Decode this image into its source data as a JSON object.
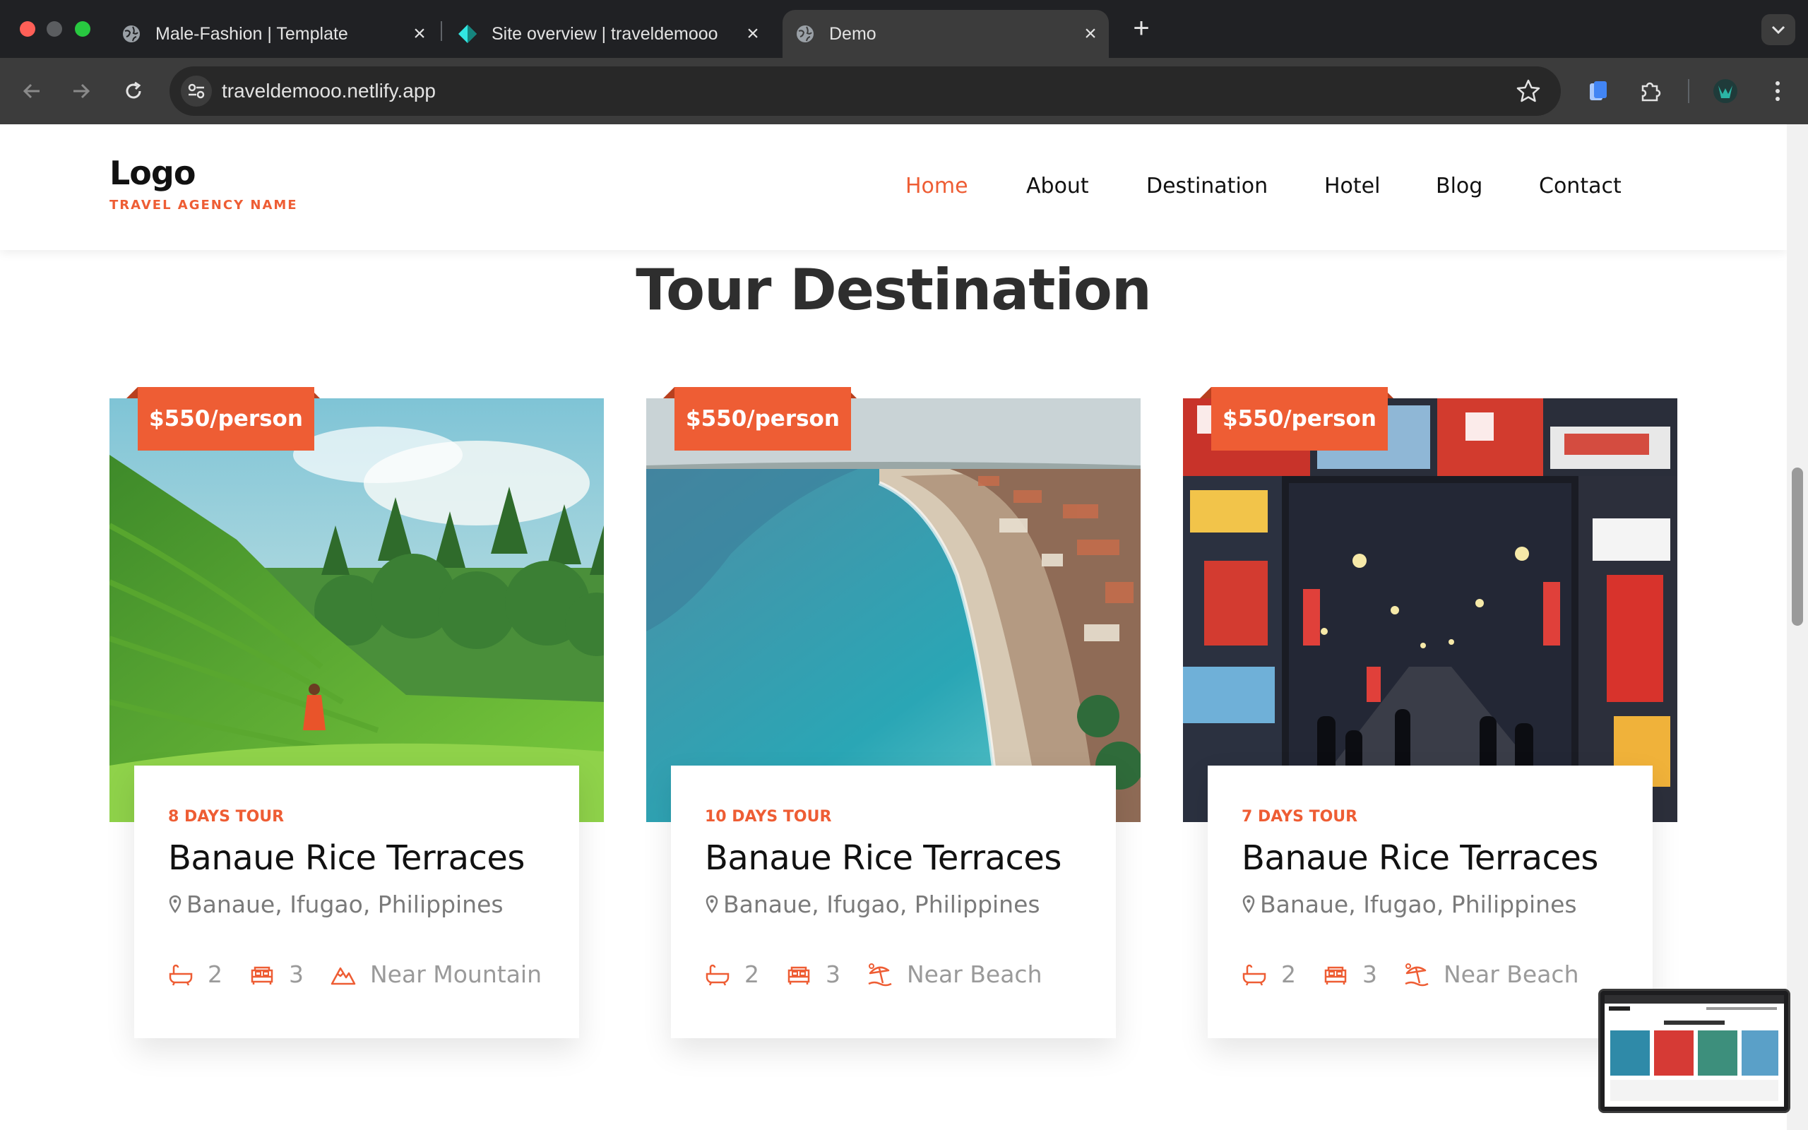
{
  "browser": {
    "tabs": [
      {
        "title": "Male-Fashion | Template",
        "active": false,
        "icon": "globe-icon"
      },
      {
        "title": "Site overview | traveldemooo",
        "active": false,
        "icon": "netlify-icon"
      },
      {
        "title": "Demo",
        "active": true,
        "icon": "globe-icon"
      }
    ],
    "url": "traveldemooo.netlify.app"
  },
  "site": {
    "logo": {
      "title": "Logo",
      "subtitle": "TRAVEL AGENCY NAME"
    },
    "nav": [
      {
        "label": "Home",
        "active": true
      },
      {
        "label": "About",
        "active": false
      },
      {
        "label": "Destination",
        "active": false
      },
      {
        "label": "Hotel",
        "active": false
      },
      {
        "label": "Blog",
        "active": false
      },
      {
        "label": "Contact",
        "active": false
      }
    ],
    "section_title": "Tour Destination",
    "accent_color": "#ee5d34",
    "cards": [
      {
        "price": "$550/person",
        "duration": "8 DAYS TOUR",
        "name": "Banaue Rice Terraces",
        "location": "Banaue, Ifugao, Philippines",
        "bathtubs": "2",
        "beds": "3",
        "feature": "Near Mountain",
        "feature_icon": "mountain-icon",
        "image": "rice-terraces-photo"
      },
      {
        "price": "$550/person",
        "duration": "10 DAYS TOUR",
        "name": "Banaue Rice Terraces",
        "location": "Banaue, Ifugao, Philippines",
        "bathtubs": "2",
        "beds": "3",
        "feature": "Near Beach",
        "feature_icon": "beach-umbrella-icon",
        "image": "coastal-beach-photo"
      },
      {
        "price": "$550/person",
        "duration": "7 DAYS TOUR",
        "name": "Banaue Rice Terraces",
        "location": "Banaue, Ifugao, Philippines",
        "bathtubs": "2",
        "beds": "3",
        "feature": "Near Beach",
        "feature_icon": "beach-umbrella-icon",
        "image": "city-street-night-photo"
      }
    ]
  }
}
